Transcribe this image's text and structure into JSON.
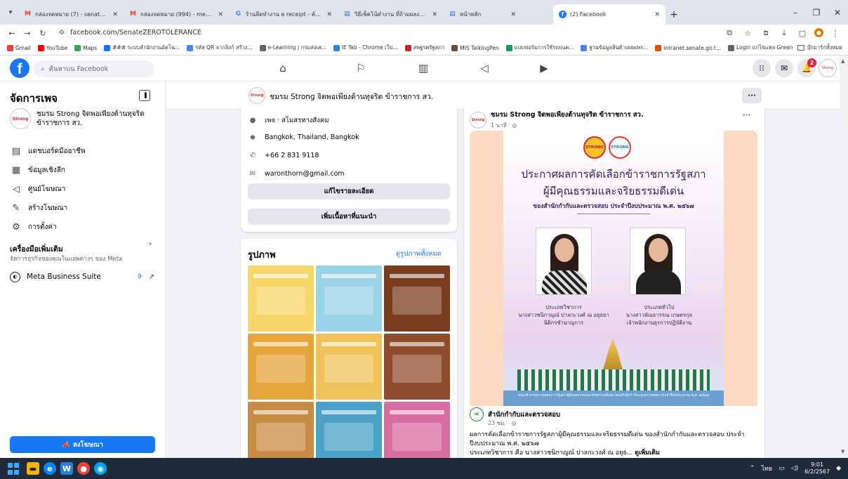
{
  "browser": {
    "tabs": [
      {
        "title": "กล่องจดหมาย (7) - senate9329@",
        "icon": "gmail-icon",
        "active": false
      },
      {
        "title": "กล่องจดหมาย (994) - mew.tim.tn",
        "icon": "gmail-icon",
        "active": false
      },
      {
        "title": "ร้านลีดทำงาน e receipt - ค้นหาด้วย",
        "icon": "google-icon",
        "active": false
      },
      {
        "title": "วิธีเช็คโน้ตำงาน ที่ถ้ามผลงานผู้เรียน",
        "icon": "doc-icon",
        "active": false
      },
      {
        "title": "หน้าหลัก",
        "icon": "list-icon",
        "active": false
      },
      {
        "title": "(2) Facebook",
        "icon": "facebook-icon",
        "active": true
      }
    ],
    "url": "facebook.com/SenateZEROTOLERANCE",
    "bookmarks": [
      {
        "label": "Gmail",
        "color": "#ea4335"
      },
      {
        "label": "YouTube",
        "color": "#ff0000"
      },
      {
        "label": "Maps",
        "color": "#34a853"
      },
      {
        "label": "### ระบบสำนักงานอัตโน...",
        "color": "#1a73e8"
      },
      {
        "label": "รหัส QR จากลิงก์ สร้าง...",
        "color": "#4285f4"
      },
      {
        "label": "e-Learning | กรมส่งเส...",
        "color": "#5f6368"
      },
      {
        "label": "IE Tab - Chrome เว็บ...",
        "color": "#1e88e5"
      },
      {
        "label": "สพฐรตรัฐสภา",
        "color": "#c62828"
      },
      {
        "label": "MIS TalkingPen",
        "color": "#6d4c41"
      },
      {
        "label": "แบบฟอร์มการใช้รถยนต...",
        "color": "#0f9d58"
      },
      {
        "label": "ฐานข้อมูลสินค้าเผยแพร...",
        "color": "#4285f4"
      },
      {
        "label": "intranet.senate.go.t...",
        "color": "#e65100"
      },
      {
        "label": "Login แก่ไขแหล Green",
        "color": "#5f6368"
      }
    ],
    "all_bookmarks": "บุ๊กมาร์กทั้งหมด"
  },
  "fb": {
    "search_placeholder": "ค้นหาบน Facebook",
    "notification_count": "2"
  },
  "sidebar": {
    "title": "จัดการเพจ",
    "page_name": "ชมรม Strong จิตพอเพียงต้านทุจริต ข้าราชการ สว.",
    "avatar_text": "Strong",
    "items": [
      {
        "label": "แดชบอร์ดมืออาชีพ",
        "icon": "dashboard-icon"
      },
      {
        "label": "ข้อมูลเชิงลึก",
        "icon": "insights-icon"
      },
      {
        "label": "ศูนย์โฆษณา",
        "icon": "megaphone-icon"
      },
      {
        "label": "สร้างโฆษณา",
        "icon": "edit-icon"
      },
      {
        "label": "การตั้งค่า",
        "icon": "gear-icon"
      }
    ],
    "tools_title": "เครื่องมือเพิ่มเติม",
    "tools_subtitle": "จัดการธุรกิจของคุณในแอพต่างๆ ของ Meta",
    "mbs_label": "Meta Business Suite",
    "mbs_count": "9",
    "advertise_label": "ลงโฆษณา"
  },
  "page_header": {
    "name": "ชมรม Strong จิตพอเพียงต้านทุจริต ข้าราชการ สว."
  },
  "intro": {
    "category": "เพจ · สโมสรทางสังคม",
    "category_bold": "เพจ",
    "location": "Bangkok, Thailand, Bangkok",
    "phone": "+66 2 831 9118",
    "email": "waronthorn@gmail.com",
    "edit_button": "แก้ไขรายละเอียด",
    "add_featured_button": "เพิ่มเนื้อหาที่แนะนำ"
  },
  "photos": {
    "title": "รูปภาพ",
    "see_all": "ดูรูปภาพทั้งหมด",
    "tiles": [
      "#f7d66a",
      "#9bd3e6",
      "#7a3c1f",
      "#e5a63b",
      "#f0c35a",
      "#8f4e2b",
      "#c98c44",
      "#4aa3c7",
      "#d96ea0"
    ]
  },
  "post": {
    "author": "ชมรม Strong จิตพอเพียงต้านทุจริต ข้าราชการ สว.",
    "time": "1 นาที · ",
    "poster": {
      "logo1": "STRONG",
      "logo2": "STRONG",
      "headline1": "ประกาศผลการคัดเลือกข้าราชการรัฐสภา",
      "headline2": "ผู้มีคุณธรรมและจริยธรรมดีเด่น",
      "subheadline": "ของสำนักกำกับและตรวจสอบ ประจำปีงบประมาณ พ.ศ. ๒๕๖๗",
      "person1_type": "ประเภทวิชาการ",
      "person1_name": "นางสาวชนิกาญณ์ ปาลกะวงศ์ ณ อยุธยา",
      "person1_role": "นิติกรชำนาญการ",
      "person2_type": "ประเภททั่วไป",
      "person2_name": "นางสาวพัณธารรณ เกษตรกุล",
      "person2_role": "เจ้าพนักงานธุรการปฏิบัติงาน",
      "footer": "คณะทำงานตรวจสอบการรัฐสภาผู้มีคุณธรรมและจริยธรรมดีเด่น ของสำนักกำกับและตรวจสอบ ประจำปีงบประมาณ พ.ศ. ๒๕๖๗"
    },
    "shared_author": "สำนักกำกับและตรวจสอบ",
    "shared_time": "23 ชม. · ",
    "body_line1": "ผลการคัดเลือกข้าราชการรัฐสภาผู้มีคุณธรรมและจริยธรรมดีเด่น ของสำนักกำกับและตรวจสอบ ประจำ",
    "body_line2": "ปีงบประมาณ พ.ศ. ๒๕๖๗",
    "body_line3": "ประเภทวิชาการ คือ นางสาวชนิกาญณ์ ปาลกะวงศ์ ณ อยุธ...",
    "see_more": "ดูเพิ่มเติม"
  },
  "taskbar": {
    "lang": "ไทย",
    "time": "9:01",
    "date": "6/2/2567"
  }
}
